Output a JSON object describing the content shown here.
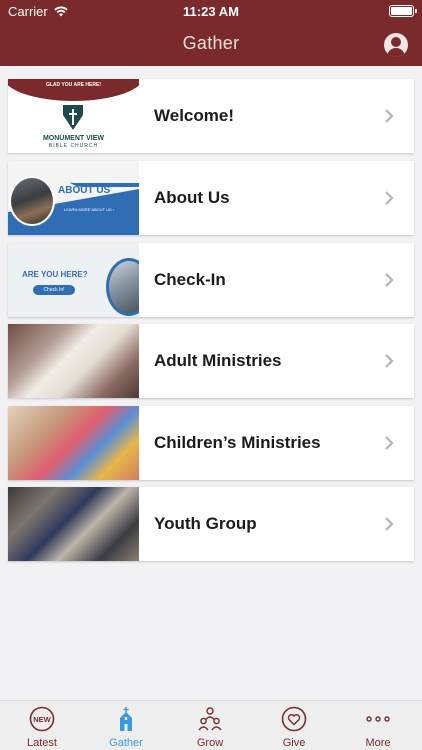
{
  "status_bar": {
    "carrier": "Carrier",
    "time": "11:23 AM"
  },
  "header": {
    "title": "Gather"
  },
  "colors": {
    "brand": "#7a2a2a",
    "active_tab": "#3b9ad9",
    "background": "#f2f2f4"
  },
  "items": [
    {
      "label": "Welcome!",
      "thumb": {
        "banner": "GLAD YOU ARE HERE!",
        "name": "MONUMENT VIEW",
        "subname": "BIBLE CHURCH"
      }
    },
    {
      "label": "About Us",
      "thumb": {
        "title": "ABOUT US",
        "subtitle": "LEARN MORE ABOUT US ›"
      }
    },
    {
      "label": "Check-In",
      "thumb": {
        "title": "ARE YOU HERE?",
        "button": "Check In!"
      }
    },
    {
      "label": "Adult Ministries"
    },
    {
      "label": "Children’s Ministries"
    },
    {
      "label": "Youth Group"
    }
  ],
  "tabs": [
    {
      "label": "Latest",
      "icon": "new-badge-icon",
      "badge": "NEW",
      "active": false
    },
    {
      "label": "Gather",
      "icon": "church-icon",
      "active": true
    },
    {
      "label": "Grow",
      "icon": "people-group-icon",
      "active": false
    },
    {
      "label": "Give",
      "icon": "heart-icon",
      "active": false
    },
    {
      "label": "More",
      "icon": "more-dots-icon",
      "active": false
    }
  ]
}
